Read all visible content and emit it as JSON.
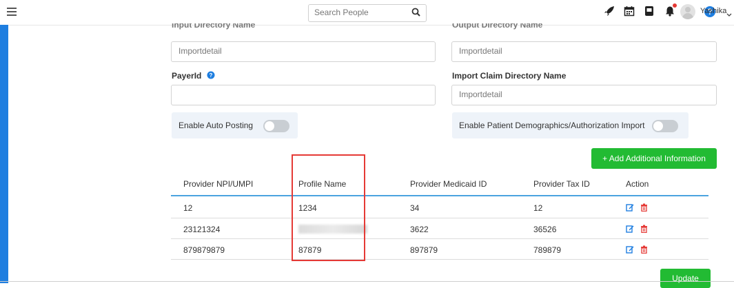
{
  "header": {
    "search_placeholder": "Search People",
    "user_name": "Yashika",
    "icons": [
      "menu-icon",
      "search-icon",
      "rocket-icon",
      "calendar-icon",
      "book-icon",
      "bell-icon",
      "gear-icon",
      "help-icon",
      "avatar",
      "chevron-down-icon"
    ],
    "notification_color": "#e53935"
  },
  "form": {
    "input_dir_label": "Input Directory Name",
    "input_dir_value": "Importdetail",
    "output_dir_label": "Output Directory Name",
    "output_dir_value": "Importdetail",
    "payer_label": "PayerId",
    "payer_value": "",
    "import_claim_label": "Import Claim Directory Name",
    "import_claim_value": "Importdetail",
    "auto_posting_label": "Enable Auto Posting",
    "auto_posting_on": false,
    "patient_demo_label": "Enable Patient Demographics/Authorization Import",
    "patient_demo_on": false
  },
  "buttons": {
    "add_info": "+ Add Additional Information",
    "update": "Update",
    "accent": "#22bb33"
  },
  "table": {
    "headers": [
      "Provider NPI/UMPI",
      "Profile Name",
      "Provider Medicaid ID",
      "Provider Tax ID",
      "Action"
    ],
    "rows": [
      {
        "npi": "12",
        "profile": "1234",
        "medicaid": "34",
        "tax": "12"
      },
      {
        "npi": "23121324",
        "profile": "",
        "medicaid": "3622",
        "tax": "36526"
      },
      {
        "npi": "879879879",
        "profile": "87879",
        "medicaid": "897879",
        "tax": "789879"
      }
    ],
    "header_line_color": "#4aa3df"
  }
}
